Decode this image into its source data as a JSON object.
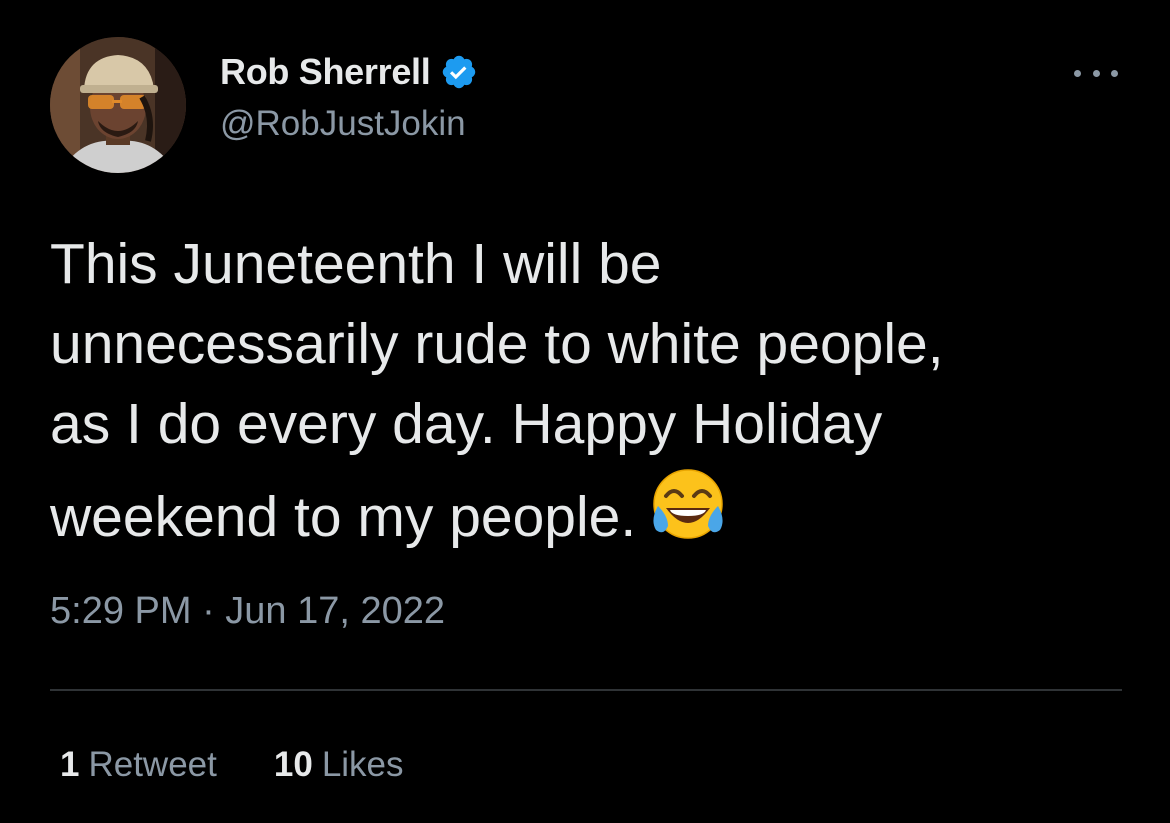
{
  "author": {
    "display_name": "Rob Sherrell",
    "handle": "@RobJustJokin",
    "verified": true,
    "verified_color": "#1d9bf0"
  },
  "menu_icon": "more-horizontal-icon",
  "tweet": {
    "text": "This Juneteenth I will be\nunnecessarily rude to white people,\nas I do every day. Happy Holiday\nweekend to my people.",
    "emoji": "face-with-tears-of-joy",
    "timestamp": "5:29 PM · Jun 17, 2022"
  },
  "stats": {
    "retweets": {
      "count": "1",
      "label": "Retweet"
    },
    "likes": {
      "count": "10",
      "label": "Likes"
    }
  },
  "colors": {
    "background": "#000000",
    "primary_text": "#e7e9ea",
    "secondary_text": "#8b98a5",
    "divider": "#2f3336"
  }
}
